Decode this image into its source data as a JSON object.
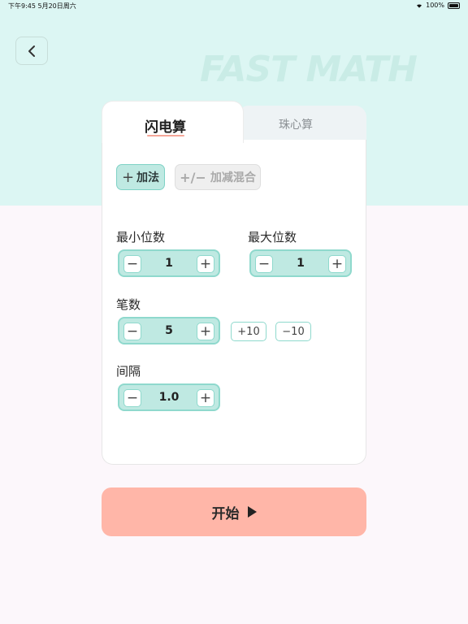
{
  "status": {
    "time_date": "下午9:45   5月20日周六",
    "battery": "100%"
  },
  "brand": "FAST MATH",
  "tabs": [
    {
      "label": "闪电算"
    },
    {
      "label": "珠心算"
    }
  ],
  "modes": [
    {
      "label": "加法",
      "icon": "+"
    },
    {
      "label": "加减混合",
      "icon": "+/−"
    }
  ],
  "settings": {
    "min_digits": {
      "label": "最小位数",
      "value": "1"
    },
    "max_digits": {
      "label": "最大位数",
      "value": "1"
    },
    "count": {
      "label": "笔数",
      "value": "5",
      "plus10": "+10",
      "minus10": "−10"
    },
    "interval": {
      "label": "间隔",
      "value": "1.0"
    }
  },
  "start": {
    "label": "开始"
  },
  "colors": {
    "accent": "#bfe9e2",
    "start": "#ffb6a8",
    "top_bg": "#dcf6f3"
  }
}
